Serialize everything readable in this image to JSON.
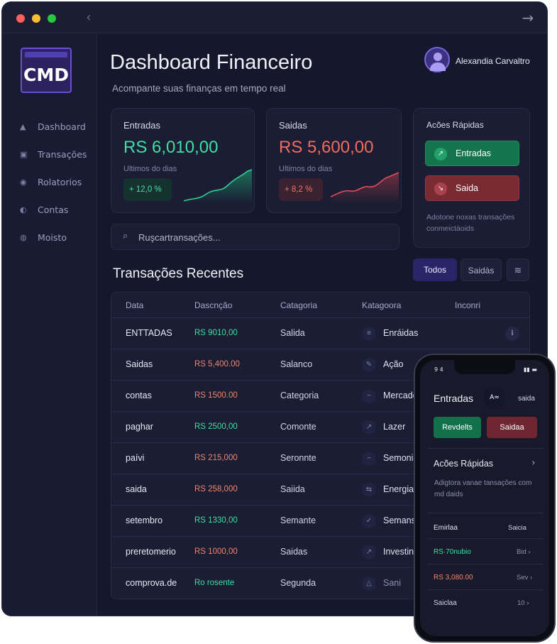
{
  "window": {
    "back_icon": "chevron-left-icon",
    "forward_icon": "arrow-right-icon"
  },
  "logo": {
    "text": "CMD"
  },
  "sidebar": {
    "items": [
      {
        "label": "Dashboard",
        "icon": "home-icon"
      },
      {
        "label": "Transações",
        "icon": "calendar-icon"
      },
      {
        "label": "Rolatorios",
        "icon": "report-icon"
      },
      {
        "label": "Contas",
        "icon": "accounts-icon"
      },
      {
        "label": "Moisto",
        "icon": "settings-icon"
      }
    ]
  },
  "header": {
    "title": "Dashboard Financeiro",
    "subtitle": "Acompante suas finanças em tempo real",
    "user_name": "Alexandia Carvaltro"
  },
  "cards": {
    "entradas": {
      "label": "Entradas",
      "amount": "RS 6,010,00",
      "note": "Ultimos do dias",
      "change": "+ 12,0 %",
      "color": "#3ee0a0"
    },
    "saidas": {
      "label": "Saidas",
      "amount": "RS 5,600,00",
      "note": "Ultimos do dias",
      "change": "+ 8,2 %",
      "color": "#f26b5d"
    }
  },
  "quick_actions": {
    "title": "Acões Rápidas",
    "entradas_label": "Entradas",
    "saida_label": "Saida",
    "note": "Adotone noxas transações conmeictàoids"
  },
  "search": {
    "placeholder": "Ruşcartransações..."
  },
  "transactions": {
    "title": "Transações Recentes",
    "filters": {
      "todos": "Todos",
      "saidas": "Saidàs"
    },
    "columns": [
      "Data",
      "Dascnção",
      "Catagoria",
      "Katagoora",
      "Inconri"
    ],
    "rows": [
      {
        "data": "ENTTADAS",
        "amount": "RS 9010,00",
        "type": "in",
        "categoria": "Salida",
        "katagoora": "Enráidas",
        "extra": "ℹ"
      },
      {
        "data": "Saidas",
        "amount": "RS 5,400.00",
        "type": "out",
        "categoria": "Salanco",
        "katagoora": "Ação",
        "extra": ""
      },
      {
        "data": "contas",
        "amount": "RS 1500.00",
        "type": "out",
        "categoria": "Categoria",
        "katagoora": "Mercado",
        "extra": ""
      },
      {
        "data": "paghar",
        "amount": "RS 2500,00",
        "type": "in",
        "categoria": "Comonte",
        "katagoora": "Lazer",
        "extra": ""
      },
      {
        "data": "paívi",
        "amount": "RS 215,000",
        "type": "out",
        "categoria": "Seronnte",
        "katagoora": "Semonia",
        "extra": ""
      },
      {
        "data": "saida",
        "amount": "RS 258,000",
        "type": "out",
        "categoria": "Saiida",
        "katagoora": "Energia",
        "extra": ""
      },
      {
        "data": "setembro",
        "amount": "RS 1330,00",
        "type": "in",
        "categoria": "Semante",
        "katagoora": "Semans",
        "extra": ""
      },
      {
        "data": "preretomerio",
        "amount": "RS 1000,00",
        "type": "out",
        "categoria": "Saidas",
        "katagoora": "Investin",
        "extra": ""
      },
      {
        "data": "comprova.de",
        "amount": "Ro rosente",
        "type": "in",
        "categoria": "Segunda",
        "katagoora": "Sani",
        "extra": ""
      }
    ]
  },
  "phone": {
    "time": "9 4",
    "title": "Entradas",
    "circle_label": "A≈",
    "saida": "saida",
    "btn_green": "Revdelts",
    "btn_red": "Saidaa",
    "quick_title": "Acões Rápidas",
    "quick_note": "Adigtora vanae tansações com md daids",
    "list_header_left": "Emirlaa",
    "list_header_right": "Saicia",
    "rows": [
      {
        "left": "RS·70nubio",
        "right": "Bid ›"
      },
      {
        "left": "RS 3,080.00",
        "right": "Sev ›"
      },
      {
        "left": "Saiclaa",
        "right": "10 ›"
      }
    ]
  },
  "colors": {
    "income": "#3ee0a0",
    "expense": "#f26b5d",
    "accent": "#2a2468",
    "background": "#15182c"
  }
}
